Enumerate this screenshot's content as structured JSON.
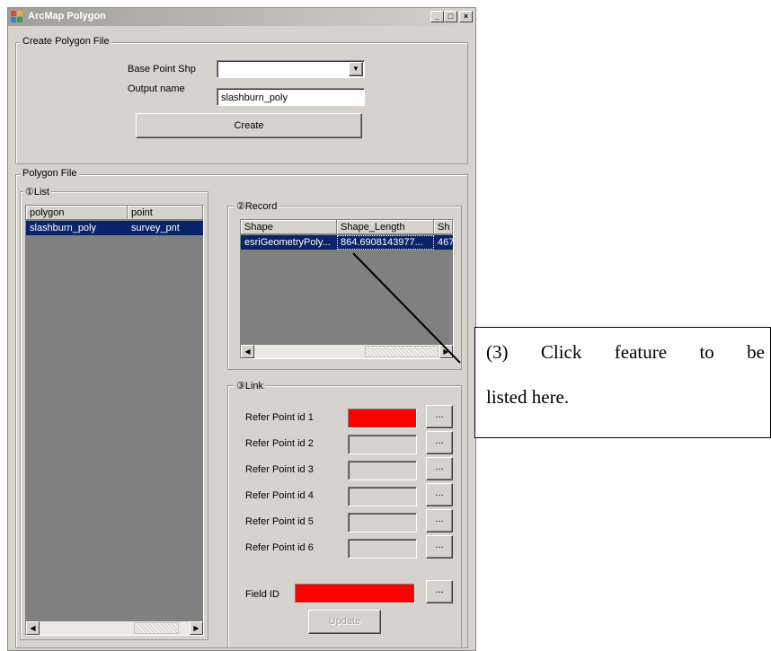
{
  "window": {
    "title": "ArcMap Polygon",
    "controls": [
      "_",
      "□",
      "×"
    ]
  },
  "create_group": {
    "legend": "Create Polygon File",
    "base_point_label": "Base Point Shp",
    "base_point_value": "",
    "output_name_label": "Output name",
    "output_name_value": "slashburn_poly",
    "create_button": "Create"
  },
  "polygon_group": {
    "legend": "Polygon File",
    "list": {
      "legend": "①List",
      "columns": [
        "polygon",
        "point"
      ],
      "rows": [
        [
          "slashburn_poly",
          "survey_pnt"
        ]
      ]
    },
    "record": {
      "legend": "②Record",
      "columns": [
        "Shape",
        "Shape_Length",
        "Sh"
      ],
      "rows": [
        [
          "esriGeometryPoly...",
          "864.6908143977...",
          "467"
        ]
      ]
    },
    "link": {
      "legend": "③Link",
      "refer_points": [
        {
          "label": "Refer Point id 1",
          "filled": true
        },
        {
          "label": "Refer Point id 2",
          "filled": false
        },
        {
          "label": "Refer Point id 3",
          "filled": false
        },
        {
          "label": "Refer Point id 4",
          "filled": false
        },
        {
          "label": "Refer Point id 5",
          "filled": false
        },
        {
          "label": "Refer Point id 6",
          "filled": false
        }
      ],
      "browse_label": "...",
      "field_id_label": "Field ID",
      "update_button": "Update"
    }
  },
  "callout": {
    "line1": "(3) Click feature to be",
    "line2": "listed here."
  },
  "colors": {
    "selection": "#0a246a",
    "highlight_field": "#ff0000",
    "window_face": "#d6d3ce"
  }
}
